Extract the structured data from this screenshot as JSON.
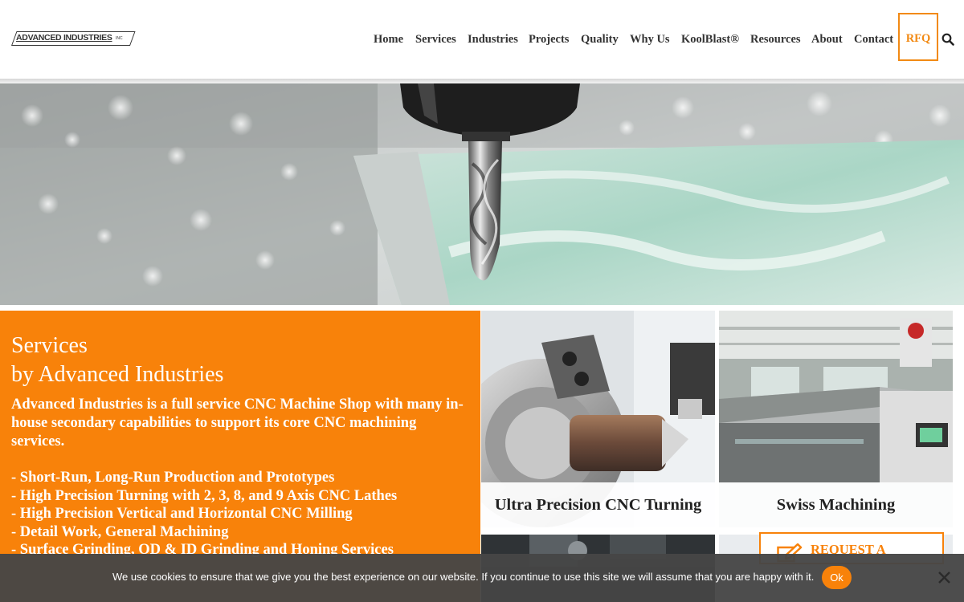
{
  "header": {
    "logo_text": "ADVANCED INDUSTRIES",
    "logo_suffix": "INC",
    "nav": [
      {
        "label": "Home"
      },
      {
        "label": "Services"
      },
      {
        "label": "Industries"
      },
      {
        "label": "Projects"
      },
      {
        "label": "Quality"
      },
      {
        "label": "Why Us"
      },
      {
        "label": "KoolBlast®"
      },
      {
        "label": "Resources"
      },
      {
        "label": "About"
      },
      {
        "label": "Contact"
      }
    ],
    "rfq_label": "RFQ",
    "search_icon": "search-icon"
  },
  "services": {
    "title_line1": "Services",
    "title_line2": "by Advanced Industries",
    "description": "Advanced Industries is a full service CNC Machine Shop with many in-house secondary capabilities to support its core CNC machining services.",
    "items": [
      "-  Short-Run, Long-Run Production and Prototypes",
      "-  High Precision Turning with 2, 3, 8, and 9 Axis CNC Lathes",
      "-  High Precision Vertical and Horizontal CNC Milling",
      "-  Detail Work, General Machining",
      "-  Surface Grinding, OD & ID Grinding and Honing Services"
    ]
  },
  "tiles": [
    {
      "caption": "Ultra Precision CNC Turning"
    },
    {
      "caption": "Swiss Machining"
    }
  ],
  "request_button": {
    "label": "REQUEST A",
    "icon": "edit-icon"
  },
  "cookie": {
    "text": "We use cookies to ensure that we give you the best experience on our website. If you continue to use this site we will assume that you are happy with it.",
    "ok_label": "Ok",
    "close_icon": "close-icon"
  },
  "colors": {
    "accent": "#f8820a",
    "text_dark": "#333333",
    "cookie_bg": "#464646"
  }
}
